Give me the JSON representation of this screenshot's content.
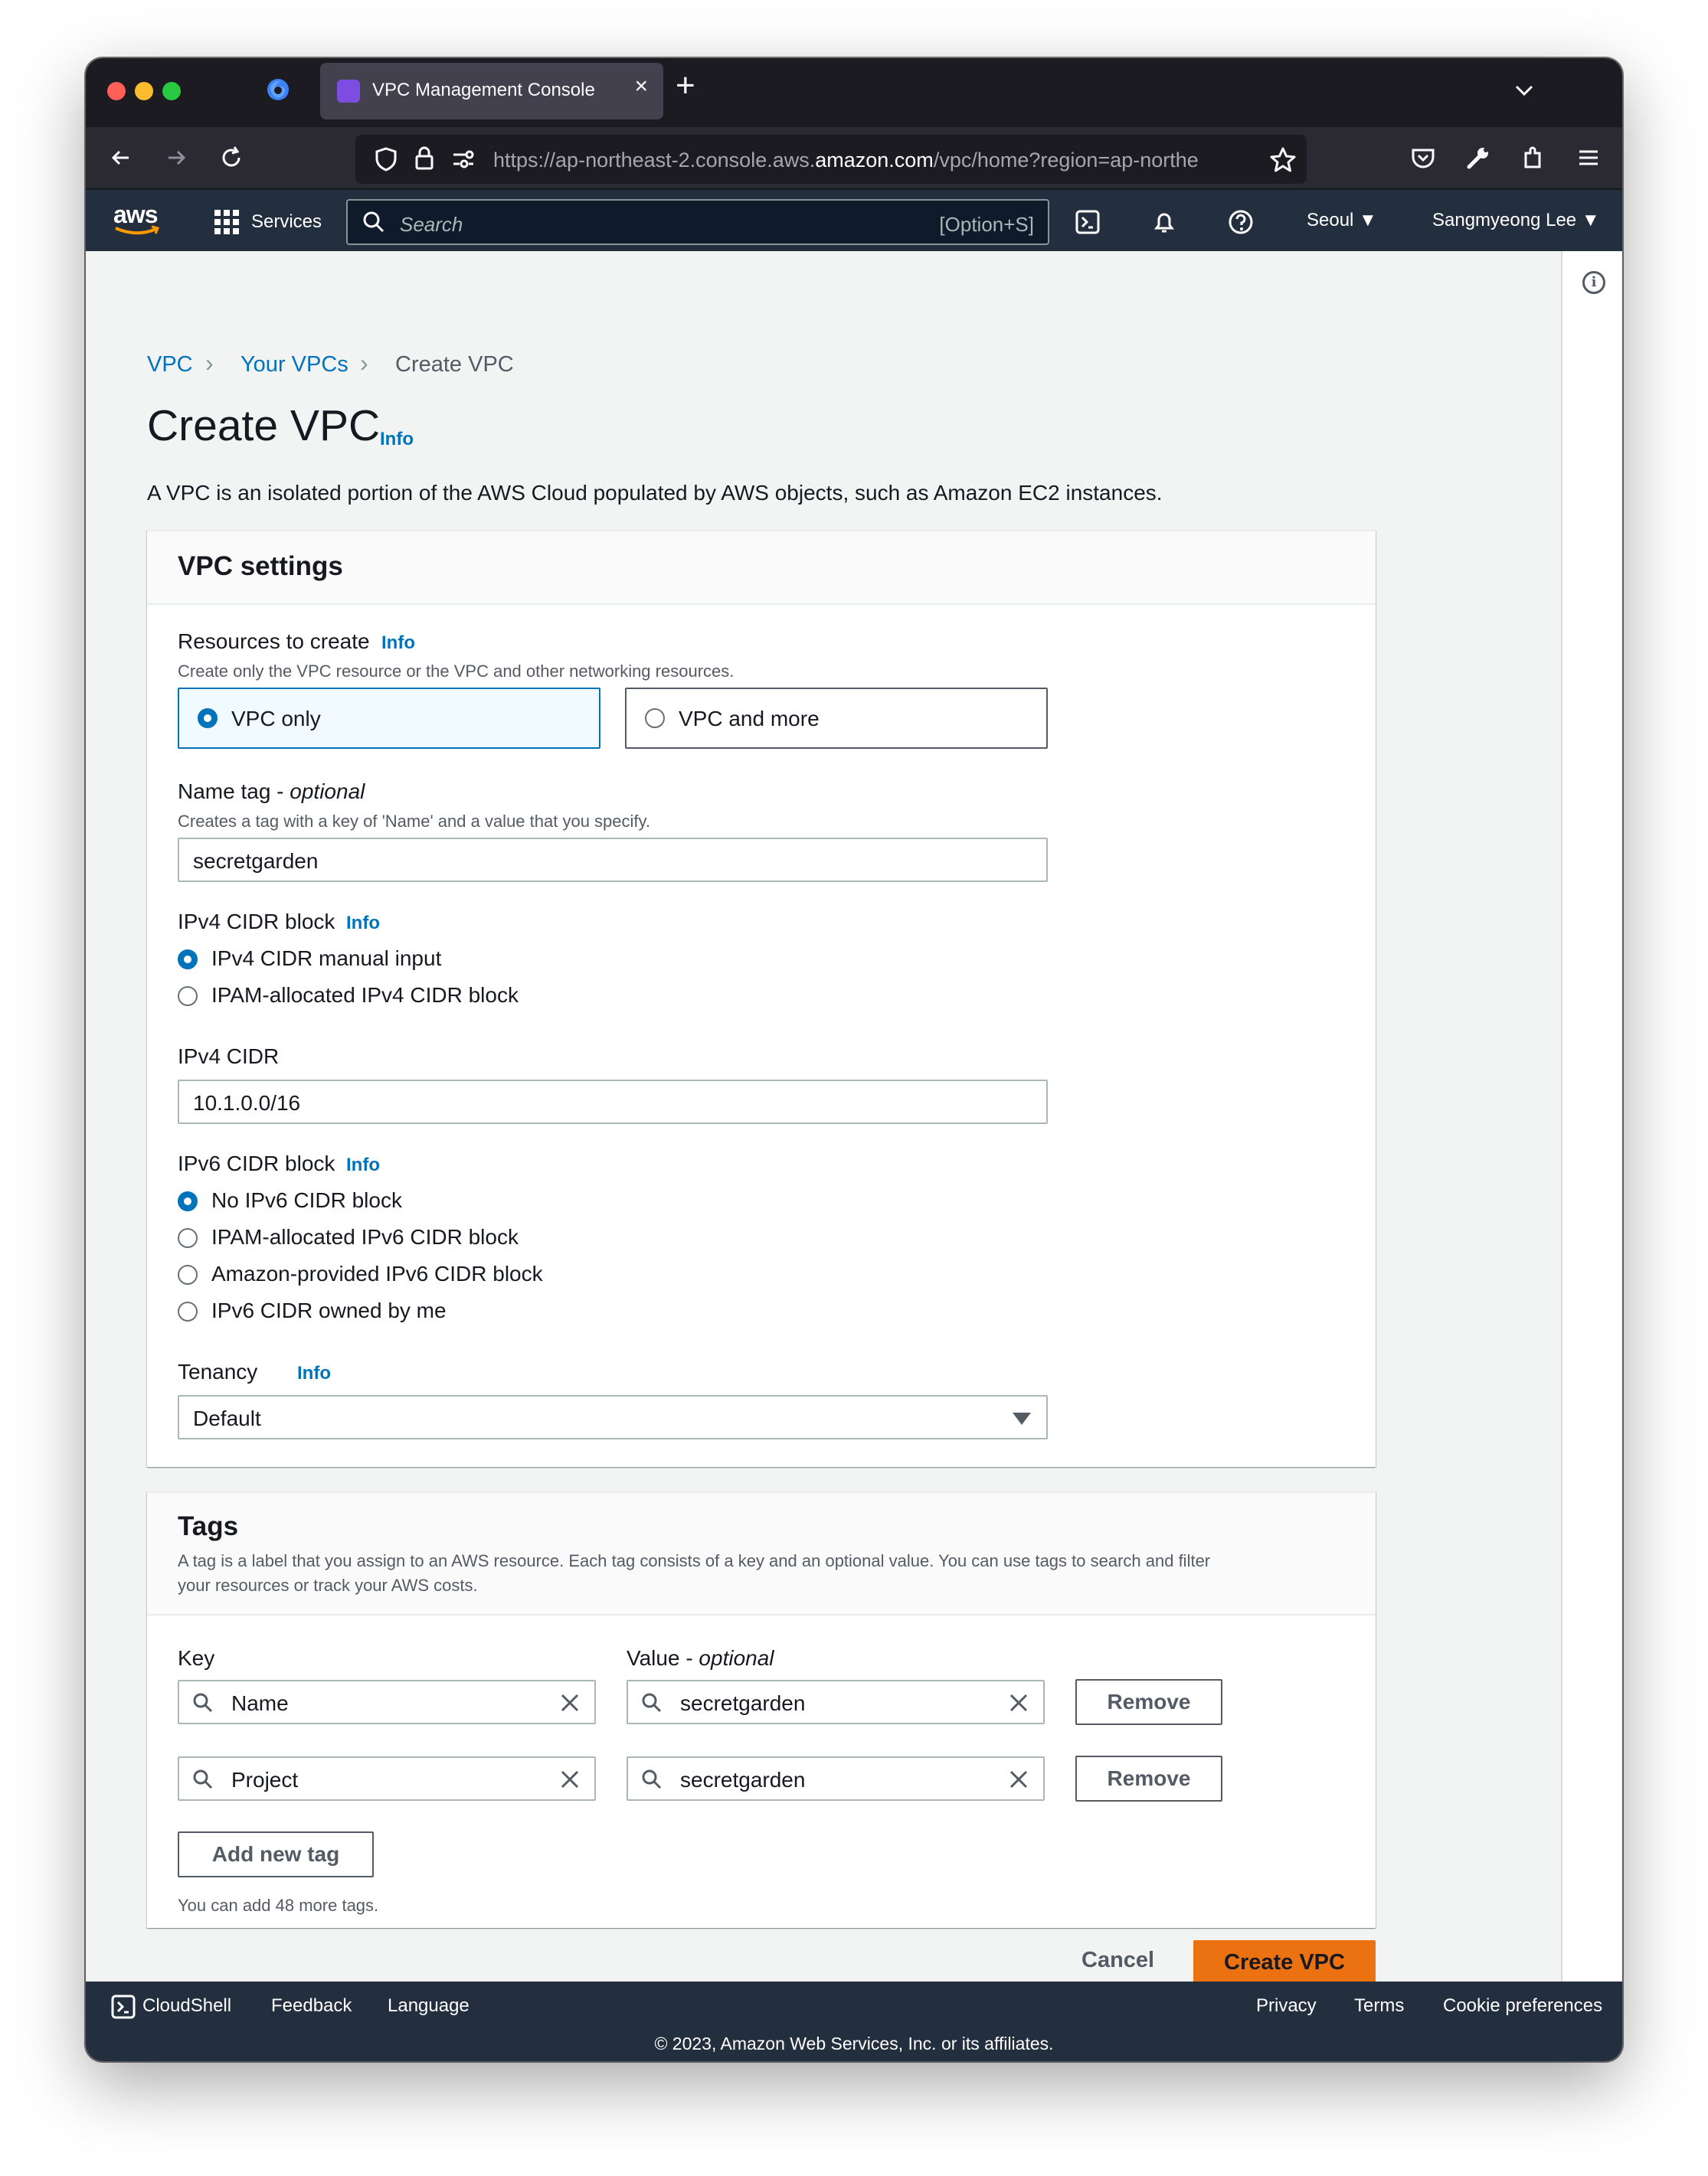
{
  "browser": {
    "tab_title": "VPC Management Console",
    "url_prefix": "https://ap-northeast-2.console.aws.",
    "url_domain": "amazon.com",
    "url_suffix": "/vpc/home?region=ap-northe"
  },
  "aws_header": {
    "logo": "aws",
    "services_label": "Services",
    "search_placeholder": "Search",
    "search_shortcut": "[Option+S]",
    "region": "Seoul ▼",
    "user": "Sangmyeong Lee ▼"
  },
  "breadcrumb": {
    "items": [
      "VPC",
      "Your VPCs",
      "Create VPC"
    ]
  },
  "page": {
    "title": "Create VPC",
    "info": "Info",
    "description": "A VPC is an isolated portion of the AWS Cloud populated by AWS objects, such as Amazon EC2 instances."
  },
  "vpc_settings": {
    "title": "VPC settings",
    "resources": {
      "label": "Resources to create",
      "info": "Info",
      "description": "Create only the VPC resource or the VPC and other networking resources.",
      "options": [
        "VPC only",
        "VPC and more"
      ],
      "selected": "VPC only"
    },
    "name_tag": {
      "label": "Name tag - ",
      "label_optional": "optional",
      "description": "Creates a tag with a key of 'Name' and a value that you specify.",
      "value": "secretgarden"
    },
    "ipv4_block": {
      "label": "IPv4 CIDR block",
      "info": "Info",
      "options": [
        "IPv4 CIDR manual input",
        "IPAM-allocated IPv4 CIDR block"
      ],
      "selected": "IPv4 CIDR manual input"
    },
    "ipv4_cidr": {
      "label": "IPv4 CIDR",
      "value": "10.1.0.0/16"
    },
    "ipv6_block": {
      "label": "IPv6 CIDR block",
      "info": "Info",
      "options": [
        "No IPv6 CIDR block",
        "IPAM-allocated IPv6 CIDR block",
        "Amazon-provided IPv6 CIDR block",
        "IPv6 CIDR owned by me"
      ],
      "selected": "No IPv6 CIDR block"
    },
    "tenancy": {
      "label": "Tenancy",
      "info": "Info",
      "value": "Default"
    }
  },
  "tags": {
    "title": "Tags",
    "description_line1": "A tag is a label that you assign to an AWS resource. Each tag consists of a key and an optional value. You can use tags to search and filter",
    "description_line2": "your resources or track your AWS costs.",
    "key_header": "Key",
    "value_header": "Value - ",
    "value_header_optional": "optional",
    "rows": [
      {
        "key": "Name",
        "value": "secretgarden",
        "remove": "Remove"
      },
      {
        "key": "Project",
        "value": "secretgarden",
        "remove": "Remove"
      }
    ],
    "add_label": "Add new tag",
    "remaining": "You can add 48 more tags."
  },
  "actions": {
    "cancel": "Cancel",
    "create": "Create VPC"
  },
  "footer": {
    "cloudshell": "CloudShell",
    "feedback": "Feedback",
    "language": "Language",
    "privacy": "Privacy",
    "terms": "Terms",
    "cookies": "Cookie preferences",
    "copyright": "© 2023, Amazon Web Services, Inc. or its affiliates."
  },
  "colors": {
    "accent": "#0073bb",
    "primary_button": "#ec7211",
    "header_bg": "#232f3e"
  }
}
